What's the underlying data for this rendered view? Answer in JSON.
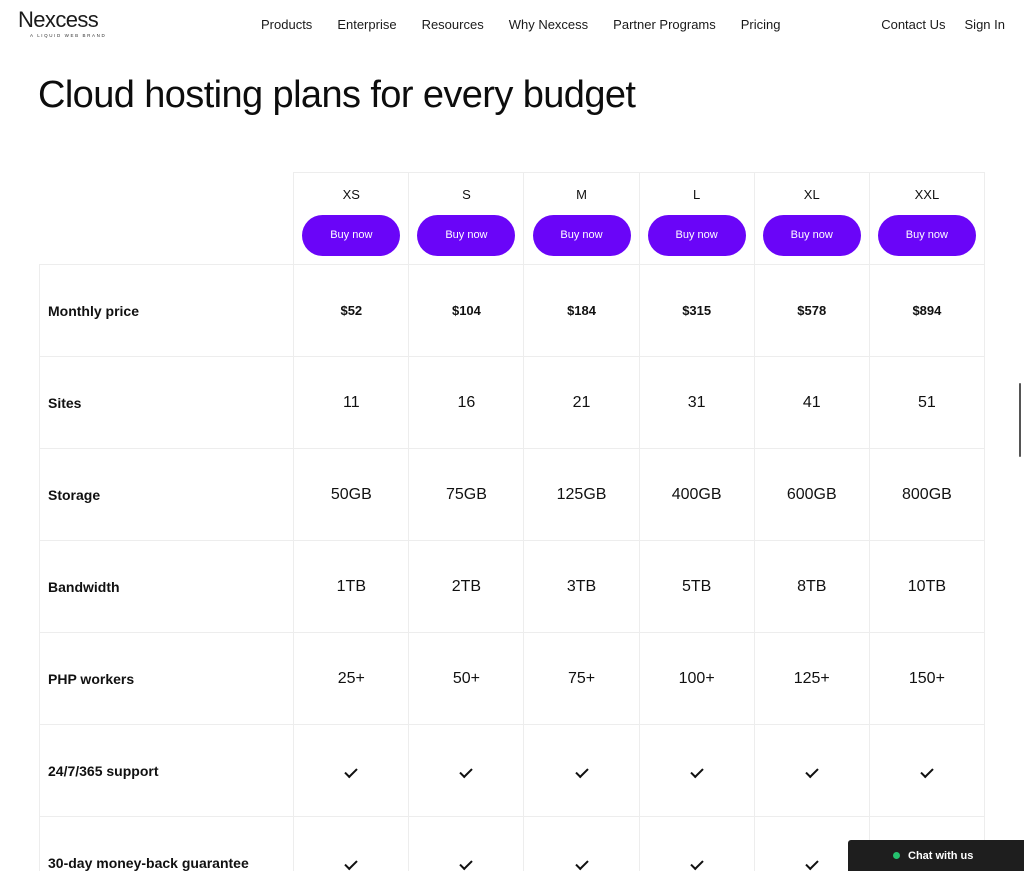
{
  "brand": {
    "name": "Nexcess",
    "tagline": "A LIQUID WEB BRAND"
  },
  "nav": {
    "items": [
      "Products",
      "Enterprise",
      "Resources",
      "Why Nexcess",
      "Partner Programs",
      "Pricing"
    ],
    "contact": "Contact Us",
    "sign_in": "Sign In"
  },
  "page": {
    "title": "Cloud hosting plans for every budget"
  },
  "table": {
    "plans": [
      "XS",
      "S",
      "M",
      "L",
      "XL",
      "XXL"
    ],
    "buy_label": "Buy now",
    "rows": [
      {
        "label": "Monthly price",
        "values": [
          "$52",
          "$104",
          "$184",
          "$315",
          "$578",
          "$894"
        ]
      },
      {
        "label": "Sites",
        "values": [
          "11",
          "16",
          "21",
          "31",
          "41",
          "51"
        ]
      },
      {
        "label": "Storage",
        "values": [
          "50GB",
          "75GB",
          "125GB",
          "400GB",
          "600GB",
          "800GB"
        ]
      },
      {
        "label": "Bandwidth",
        "values": [
          "1TB",
          "2TB",
          "3TB",
          "5TB",
          "8TB",
          "10TB"
        ]
      },
      {
        "label": "PHP workers",
        "values": [
          "25+",
          "50+",
          "75+",
          "100+",
          "125+",
          "150+"
        ]
      },
      {
        "label": "24/7/365 support",
        "check": true
      },
      {
        "label": "30-day money-back guarantee",
        "check": true
      }
    ]
  },
  "chat": {
    "label": "Chat with us"
  },
  "colors": {
    "accent": "#6a05f8",
    "chat_bg": "#1e1e1e",
    "online": "#25c16f"
  }
}
